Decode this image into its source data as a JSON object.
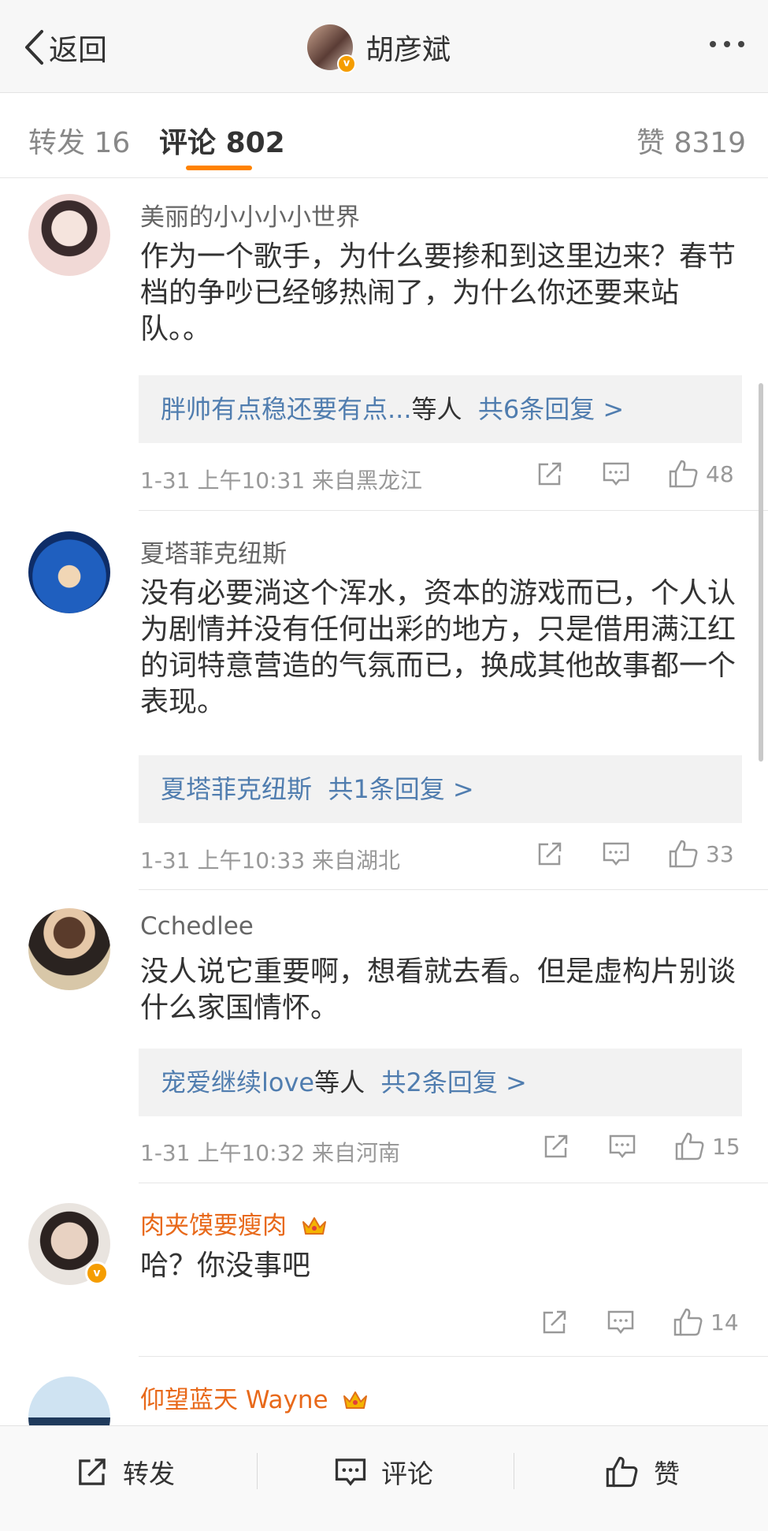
{
  "header": {
    "back_label": "返回",
    "title": "胡彦斌"
  },
  "tabs": [
    {
      "label": "转发",
      "count": "16"
    },
    {
      "label": "评论",
      "count": "802"
    },
    {
      "label": "赞",
      "count": "8319"
    }
  ],
  "comments": [
    {
      "user": "美丽的小小小小世界",
      "text": "作为一个歌手，为什么要掺和到这里边来？春节档的争吵已经够热闹了，为什么你还要来站队。。",
      "reply_users": "胖帅有点稳还要有点...",
      "reply_suffix": "等人",
      "reply_count": "共6条回复 >",
      "time": "1-31 上午10:31",
      "location": "来自黑龙江",
      "likes": "48"
    },
    {
      "user": "夏塔菲克纽斯",
      "text": "没有必要淌这个浑水，资本的游戏而已，个人认为剧情并没有任何出彩的地方，只是借用满江红的词特意营造的气氛而已，换成其他故事都一个表现。",
      "reply_users": "夏塔菲克纽斯",
      "reply_count": "共1条回复 >",
      "time": "1-31 上午10:33",
      "location": "来自湖北",
      "likes": "33"
    },
    {
      "user": "Cchedlee",
      "text": "没人说它重要啊，想看就去看。但是虚构片别谈什么家国情怀。",
      "reply_users": "宠爱继续love",
      "reply_suffix": "等人",
      "reply_count": "共2条回复 >",
      "time": "1-31 上午10:32",
      "location": "来自河南",
      "likes": "15"
    },
    {
      "user": "肉夹馍要瘦肉",
      "text": "哈？你没事吧",
      "likes": "14"
    },
    {
      "user": "仰望蓝天 Wayne"
    }
  ],
  "bottom_bar": {
    "repost": "转发",
    "comment": "评论",
    "like": "赞"
  },
  "colors": {
    "accent": "#ff8200",
    "link_blue": "#507daf",
    "vip_name": "#e8691a"
  }
}
